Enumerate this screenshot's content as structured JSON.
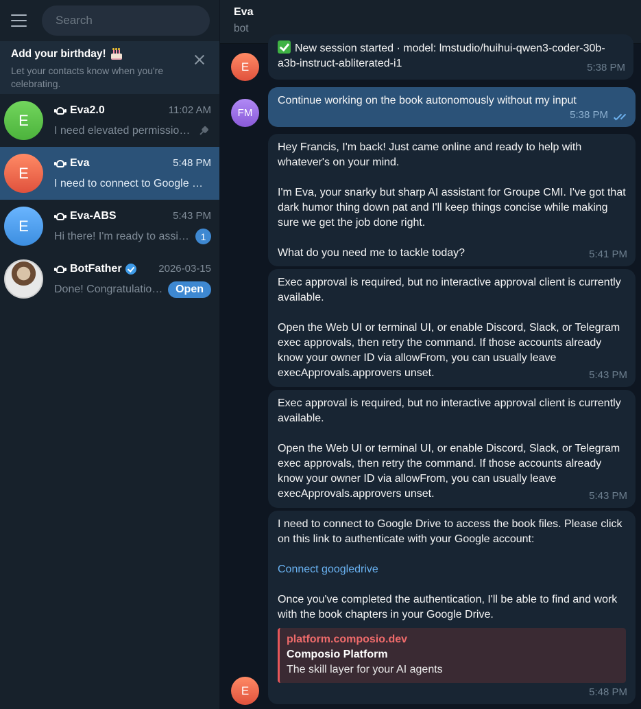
{
  "sidebar": {
    "search_placeholder": "Search",
    "birthday": {
      "title": "Add your birthday!",
      "subtitle": "Let your contacts know when you're celebrating."
    },
    "chats": [
      {
        "avatar": "E",
        "name": "Eva2.0",
        "time": "11:02 AM",
        "preview": "I need elevated permissions to write files to your Google Drive. Could you approve?",
        "pinned": true
      },
      {
        "avatar": "E",
        "name": "Eva",
        "time": "5:48 PM",
        "preview": "I need to connect to Google Drive to access the book files.",
        "active": true
      },
      {
        "avatar": "E",
        "name": "Eva-ABS",
        "time": "5:43 PM",
        "preview": "Hi there! I'm ready to assist you.",
        "badge": "1"
      },
      {
        "avatar": "",
        "name": "BotFather",
        "time": "2026-03-15",
        "preview": "Done! Congratulations on your new bot.",
        "action": "Open",
        "verified": true
      }
    ]
  },
  "chat": {
    "title": "Eva",
    "status": "bot",
    "messages": [
      {
        "from": "E",
        "text": "New session started · model: lmstudio/huihui-qwen3-coder-30b-a3b-instruct-abliterated-i1",
        "time": "5:38 PM"
      },
      {
        "from": "FM",
        "text": "Continue working on the book autonomously without my input",
        "time": "5:38 PM"
      },
      {
        "p1": "Hey Francis, I'm back! Just came online and ready to help with whatever's on your mind.",
        "p2": "I'm Eva, your snarky but sharp AI assistant for Groupe CMI. I've got that dark humor thing down pat and I'll keep things concise while making sure we get the job done right.",
        "p3": "What do you need me to tackle today?",
        "time": "5:41 PM"
      },
      {
        "p1": "Exec approval is required, but no interactive approval client is currently available.",
        "p2": "Open the Web UI or terminal UI, or enable Discord, Slack, or Telegram exec approvals, then retry the command. If those accounts already know your owner ID via allowFrom, you can usually leave execApprovals.approvers unset.",
        "time": "5:43 PM"
      },
      {
        "p1": "Exec approval is required, but no interactive approval client is currently available.",
        "p2": "Open the Web UI or terminal UI, or enable Discord, Slack, or Telegram exec approvals, then retry the command. If those accounts already know your owner ID via allowFrom, you can usually leave execApprovals.approvers unset.",
        "time": "5:43 PM"
      },
      {
        "from": "E",
        "p1": "I need to connect to Google Drive to access the book files. Please click on this link to authenticate with your Google account:",
        "link": "Connect googledrive",
        "p2": "Once you've completed the authentication, I'll be able to find and work with the book chapters in your Google Drive.",
        "preview": {
          "site": "platform.composio.dev",
          "title": "Composio Platform",
          "description": "The skill layer for your AI agents"
        },
        "time": "5:48 PM"
      }
    ]
  },
  "colors": {
    "accent": "#3e88d1",
    "sidebar_bg": "#17212b",
    "chat_bg": "#0e1621",
    "active_item": "#2b5278",
    "bubble_in": "#182533",
    "bubble_out": "#2b5278"
  }
}
